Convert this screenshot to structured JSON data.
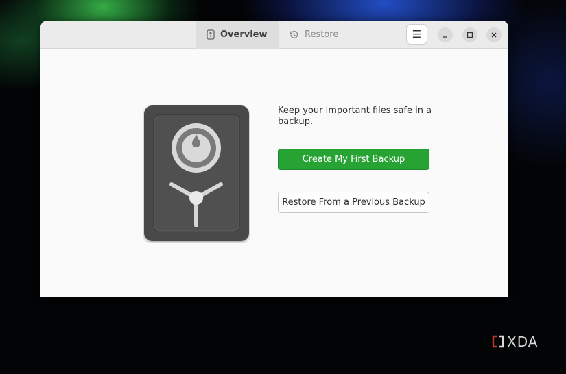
{
  "header": {
    "tabs": [
      {
        "label": "Overview",
        "icon": "safe-icon",
        "active": true
      },
      {
        "label": "Restore",
        "icon": "history-icon",
        "active": false
      }
    ],
    "menu_icon": "hamburger-menu-icon",
    "window_controls": [
      "minimize-icon",
      "maximize-icon",
      "close-icon"
    ]
  },
  "main": {
    "description": "Keep your important files safe in a backup.",
    "primary_button": "Create My First Backup",
    "secondary_button": "Restore From a Previous Backup"
  },
  "colors": {
    "accent": "#26a332",
    "safe_body": "#4a4a4a"
  },
  "watermark": {
    "text": "XDA"
  }
}
